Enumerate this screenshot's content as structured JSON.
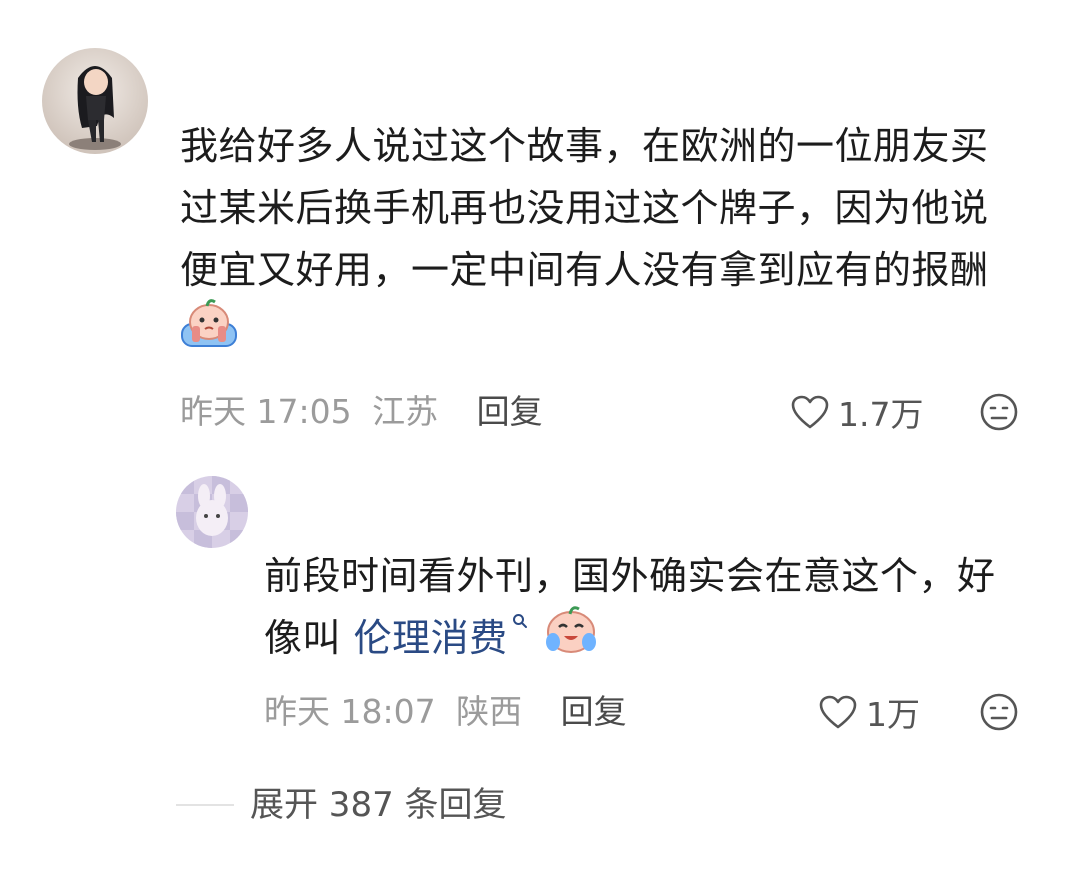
{
  "comment": {
    "lines": [
      "我给好多人说过这个故事，在欧洲的一位朋友买",
      "过某米后换手机再也没用过这个牌子，因为他说",
      "便宜又好用，一定中间有人没有拿到应有的报酬"
    ],
    "emoji": "crying-cheeks-emoji",
    "time": "昨天 17:05",
    "location": "江苏",
    "reply_label": "回复",
    "likes": "1.7万"
  },
  "reply": {
    "line1": "前段时间看外刊，国外确实会在意这个，好",
    "line2_prefix": "像叫 ",
    "link_text": "伦理消费",
    "emoji": "laughing-crying-emoji",
    "time": "昨天 18:07",
    "location": "陕西",
    "reply_label": "回复",
    "likes": "1万"
  },
  "expand": {
    "label": "展开 387 条回复"
  },
  "colors": {
    "link": "#2a4a84",
    "meta": "#9b9b9b"
  }
}
